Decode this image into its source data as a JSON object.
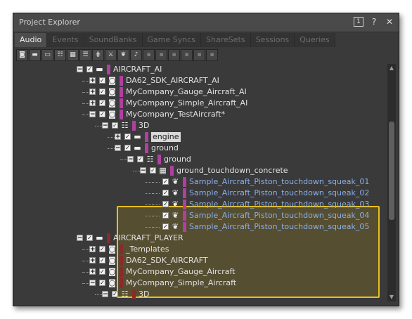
{
  "window": {
    "title": "Project Explorer"
  },
  "titlebar_icons": [
    {
      "name": "layout-icon",
      "glyph": "1"
    },
    {
      "name": "help-icon",
      "glyph": "?"
    },
    {
      "name": "close-icon",
      "glyph": "✕"
    }
  ],
  "tabs": [
    "Audio",
    "Events",
    "SoundBanks",
    "Game Syncs",
    "ShareSets",
    "Sessions",
    "Queries"
  ],
  "active_tab": "Audio",
  "toolbar": [
    {
      "name": "work-unit-icon",
      "glyph": "◙"
    },
    {
      "name": "folder-icon",
      "glyph": "▬"
    },
    {
      "name": "folder-icon",
      "glyph": "▭"
    },
    {
      "name": "switch-container-icon",
      "glyph": "☷"
    },
    {
      "name": "random-container-icon",
      "glyph": "▦"
    },
    {
      "name": "sequence-container-icon",
      "glyph": "☰"
    },
    {
      "name": "blend-container-icon",
      "glyph": "⋕"
    },
    {
      "name": "actor-mixer-icon",
      "glyph": "⚔"
    },
    {
      "name": "sound-sfx-icon",
      "glyph": "❦"
    },
    {
      "name": "voice-icon",
      "glyph": "♪"
    },
    {
      "name": "dim-icon-1",
      "glyph": "▪"
    },
    {
      "name": "dim-icon-2",
      "glyph": "▪"
    },
    {
      "name": "dim-icon-3",
      "glyph": "▪"
    },
    {
      "name": "dim-icon-4",
      "glyph": "▪"
    },
    {
      "name": "dim-icon-5",
      "glyph": "▪"
    },
    {
      "name": "dim-icon-6",
      "glyph": "▪"
    }
  ],
  "tree_rows": [
    {
      "label": "AIRCRAFT_AI",
      "icon": "folder",
      "depth": 0,
      "expand": "-",
      "color": "#b040a0"
    },
    {
      "label": "DA62_SDK_AIRCRAFT_AI",
      "icon": "workunit",
      "depth": 1,
      "expand": "+",
      "color": "#b040a0"
    },
    {
      "label": "MyCompany_Gauge_Aircraft_AI",
      "icon": "workunit",
      "depth": 1,
      "expand": "+",
      "color": "#b040a0"
    },
    {
      "label": "MyCompany_Simple_Aircraft_AI",
      "icon": "workunit",
      "depth": 1,
      "expand": "+",
      "color": "#b040a0"
    },
    {
      "label": "MyCompany_TestAircraft*",
      "icon": "workunit",
      "depth": 1,
      "expand": "-",
      "color": "#b040a0"
    },
    {
      "label": "3D",
      "icon": "switch",
      "depth": 2,
      "expand": "-",
      "color": "#b040a0"
    },
    {
      "label": "engine",
      "icon": "folder",
      "depth": 3,
      "expand": "+",
      "color": "#b040a0",
      "selected": true
    },
    {
      "label": "ground",
      "icon": "folder",
      "depth": 3,
      "expand": "-",
      "color": "#b040a0"
    },
    {
      "label": "ground",
      "icon": "switch",
      "depth": 4,
      "expand": "-",
      "color": "#b040a0"
    },
    {
      "label": "ground_touchdown_concrete",
      "icon": "random",
      "depth": 5,
      "expand": "-",
      "color": "#b040a0"
    },
    {
      "label": "Sample_Aircraft_Piston_touchdown_squeak_01",
      "icon": "sound",
      "depth": 6,
      "expand": "",
      "color": "#b040a0",
      "blue": true
    },
    {
      "label": "Sample_Aircraft_Piston_touchdown_squeak_02",
      "icon": "sound",
      "depth": 6,
      "expand": "",
      "color": "#b040a0",
      "blue": true
    },
    {
      "label": "Sample_Aircraft_Piston_touchdown_squeak_03",
      "icon": "sound",
      "depth": 6,
      "expand": "",
      "color": "#b040a0",
      "blue": true
    },
    {
      "label": "Sample_Aircraft_Piston_touchdown_squeak_04",
      "icon": "sound",
      "depth": 6,
      "expand": "",
      "color": "#b040a0",
      "blue": true
    },
    {
      "label": "Sample_Aircraft_Piston_touchdown_squeak_05",
      "icon": "sound",
      "depth": 6,
      "expand": "",
      "color": "#b040a0",
      "blue": true
    },
    {
      "label": "AIRCRAFT_PLAYER",
      "icon": "folder",
      "depth": 0,
      "expand": "-",
      "color": "#8a2a2a"
    },
    {
      "label": "_Templates",
      "icon": "workunit",
      "depth": 1,
      "expand": "+",
      "color": "#8a2a2a"
    },
    {
      "label": "DA62_SDK_AIRCRAFT",
      "icon": "workunit",
      "depth": 1,
      "expand": "+",
      "color": "#8a2a2a"
    },
    {
      "label": "MyCompany_Gauge_Aircraft",
      "icon": "workunit",
      "depth": 1,
      "expand": "+",
      "color": "#8a2a2a"
    },
    {
      "label": "MyCompany_Simple_Aircraft",
      "icon": "workunit",
      "depth": 1,
      "expand": "-",
      "color": "#8a2a2a"
    },
    {
      "label": "3D",
      "icon": "switch",
      "depth": 2,
      "expand": "-",
      "color": "#8a2a2a"
    }
  ],
  "colors": {
    "highlight_border": "#e8c01c",
    "ai_color": "#b040a0",
    "player_color": "#8a2a2a",
    "sound_text": "#8aaee8"
  }
}
